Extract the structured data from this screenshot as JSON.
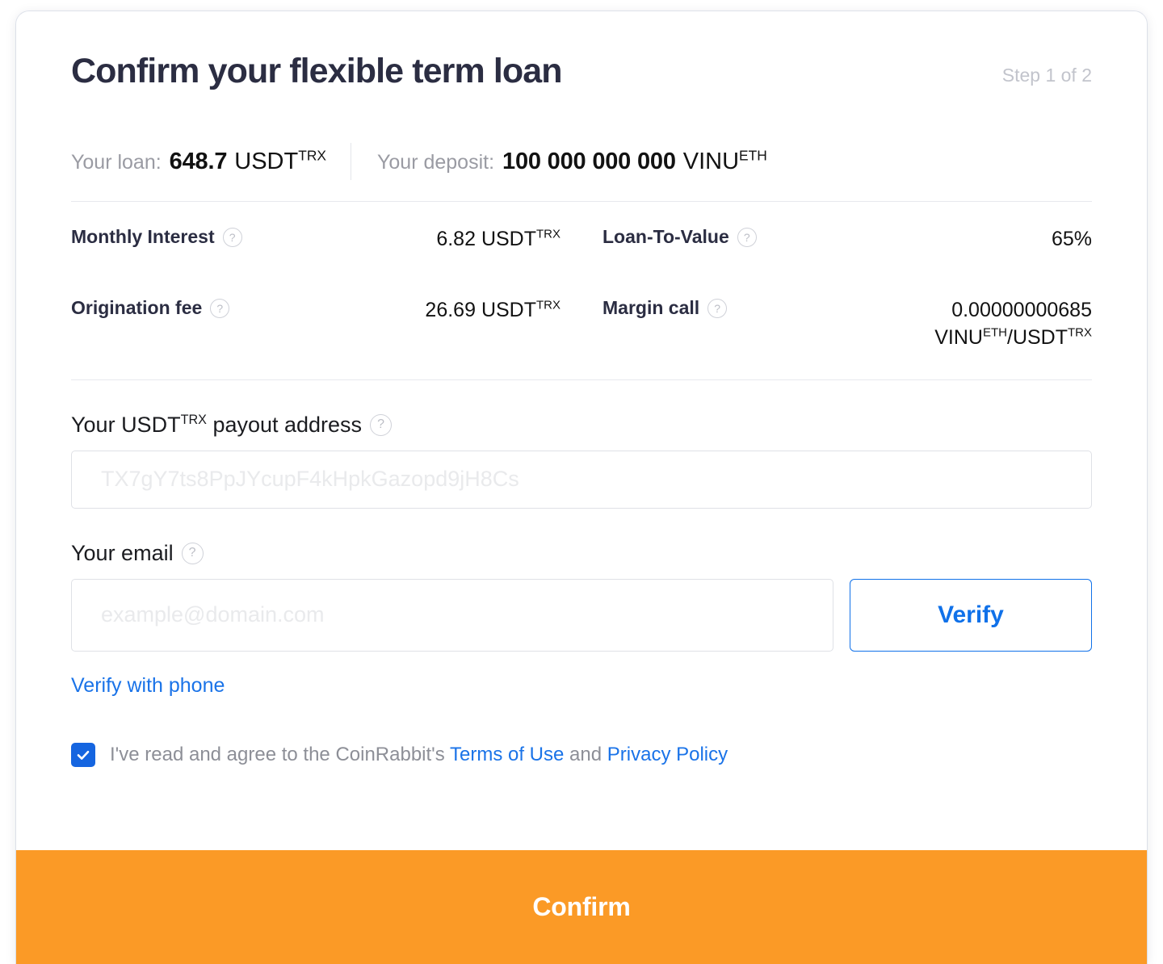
{
  "header": {
    "title": "Confirm your flexible term loan",
    "step": "Step 1 of 2"
  },
  "summary": {
    "loan_label": "Your loan:",
    "loan_amount": "648.7",
    "loan_ticker": "USDT",
    "loan_ticker_sup": "TRX",
    "deposit_label": "Your deposit:",
    "deposit_amount": "100 000 000 000",
    "deposit_ticker": "VINU",
    "deposit_ticker_sup": "ETH"
  },
  "stats": {
    "monthly_interest_label": "Monthly Interest",
    "monthly_interest_value": "6.82",
    "monthly_interest_ticker": "USDT",
    "monthly_interest_sup": "TRX",
    "ltv_label": "Loan-To-Value",
    "ltv_value": "65%",
    "origination_label": "Origination fee",
    "origination_value": "26.69",
    "origination_ticker": "USDT",
    "origination_sup": "TRX",
    "margin_call_label": "Margin call",
    "margin_call_value": "0.00000000685",
    "margin_call_pair_base": "VINU",
    "margin_call_pair_base_sup": "ETH",
    "margin_call_pair_sep": "/",
    "margin_call_pair_quote": "USDT",
    "margin_call_pair_quote_sup": "TRX",
    "help_icon": "?"
  },
  "payout": {
    "label_prefix": "Your ",
    "label_ticker": "USDT",
    "label_ticker_sup": "TRX",
    "label_suffix": " payout address",
    "placeholder": "TX7gY7ts8PpJYcupF4kHpkGazopd9jH8Cs",
    "value": ""
  },
  "email": {
    "label": "Your email",
    "placeholder": "example@domain.com",
    "value": "",
    "verify_label": "Verify",
    "phone_link": "Verify with phone"
  },
  "agreement": {
    "checked": true,
    "text_before": "I've read and agree to the CoinRabbit's",
    "terms_link": "Terms of Use",
    "conjunction": "and",
    "privacy_link": "Privacy Policy"
  },
  "footer": {
    "confirm_label": "Confirm"
  },
  "colors": {
    "accent_orange": "#fb9a26",
    "link_blue": "#1a73e8",
    "checkbox_blue": "#1565e0",
    "title_dark": "#2b2d42"
  }
}
